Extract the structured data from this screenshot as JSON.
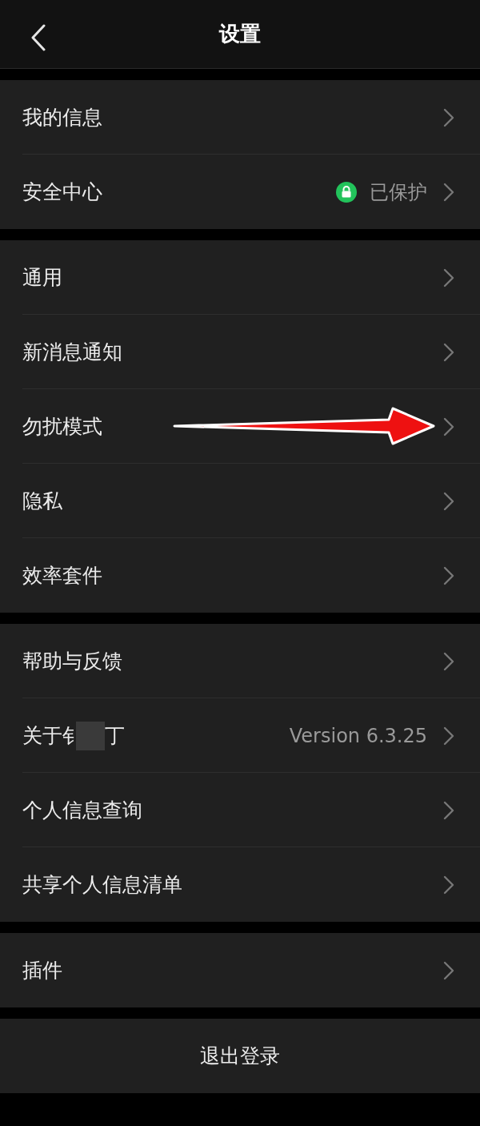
{
  "header": {
    "title": "设置"
  },
  "groups": [
    {
      "items": [
        {
          "kind": "plain",
          "label": "我的信息"
        },
        {
          "kind": "status",
          "label": "安全中心",
          "value": "已保护"
        }
      ]
    },
    {
      "items": [
        {
          "kind": "plain",
          "label": "通用"
        },
        {
          "kind": "plain",
          "label": "新消息通知"
        },
        {
          "kind": "plain",
          "label": "勿扰模式",
          "annotated": true
        },
        {
          "kind": "plain",
          "label": "隐私"
        },
        {
          "kind": "plain",
          "label": "效率套件"
        }
      ]
    },
    {
      "items": [
        {
          "kind": "plain",
          "label": "帮助与反馈"
        },
        {
          "kind": "redacted",
          "label": "关于钅",
          "label_end": "丁",
          "value": "Version 6.3.25"
        },
        {
          "kind": "plain",
          "label": "个人信息查询"
        },
        {
          "kind": "plain",
          "label": "共享个人信息清单"
        }
      ]
    },
    {
      "items": [
        {
          "kind": "plain",
          "label": "插件"
        }
      ]
    }
  ],
  "logout": {
    "label": "退出登录"
  }
}
